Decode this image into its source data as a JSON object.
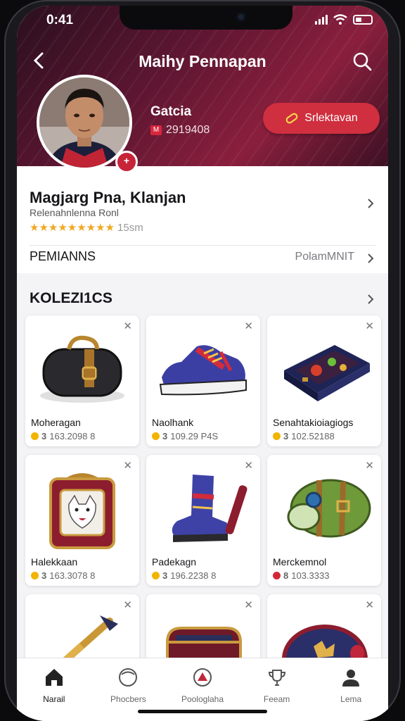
{
  "status": {
    "time": "0:41"
  },
  "header": {
    "title": "Maihy Pennapan",
    "user_name": "Gatcia",
    "user_id": "2919408",
    "chip_label": "Srlektavan"
  },
  "profile": {
    "name": "Magjarg Pna, Klanjan",
    "subtitle": "Relenahnlenna Ronl",
    "stars": "★★★★★★★★★",
    "rating_text": "15sm",
    "row_label": "PEMIANNS",
    "row_value": "PolamMNIT"
  },
  "section": {
    "title": "KOLEZI1CS"
  },
  "items": [
    {
      "name": "Moheragan",
      "price": "163.2098 8",
      "icon": "bag-icon",
      "coins": "3"
    },
    {
      "name": "Naolhank",
      "price": "109.29 P4S",
      "icon": "sneaker-icon",
      "coins": "3"
    },
    {
      "name": "Senahtakioiagiogs",
      "price": "102.52188",
      "icon": "case-icon",
      "coins": "3"
    },
    {
      "name": "Halekkaan",
      "price": "163.3078 8",
      "icon": "shield-bag-icon",
      "coins": "3"
    },
    {
      "name": "Padekagn",
      "price": "196.2238 8",
      "icon": "boot-icon",
      "coins": "3"
    },
    {
      "name": "Merckemnol",
      "price": "103.3333",
      "icon": "backpack-icon",
      "coins": "8"
    },
    {
      "name": "",
      "price": "",
      "icon": "sword-icon",
      "coins": ""
    },
    {
      "name": "",
      "price": "",
      "icon": "chest-icon",
      "coins": ""
    },
    {
      "name": "",
      "price": "",
      "icon": "pouch-icon",
      "coins": ""
    }
  ],
  "nav": [
    {
      "label": "Narail",
      "icon": "home-icon"
    },
    {
      "label": "Phocbers",
      "icon": "ball-icon"
    },
    {
      "label": "Poologlaha",
      "icon": "badge-icon"
    },
    {
      "label": "Feeam",
      "icon": "trophy-icon"
    },
    {
      "label": "Lema",
      "icon": "user-icon"
    }
  ],
  "colors": {
    "accent": "#cf2f3f",
    "header": "#5e1631",
    "star": "#f0a822"
  }
}
